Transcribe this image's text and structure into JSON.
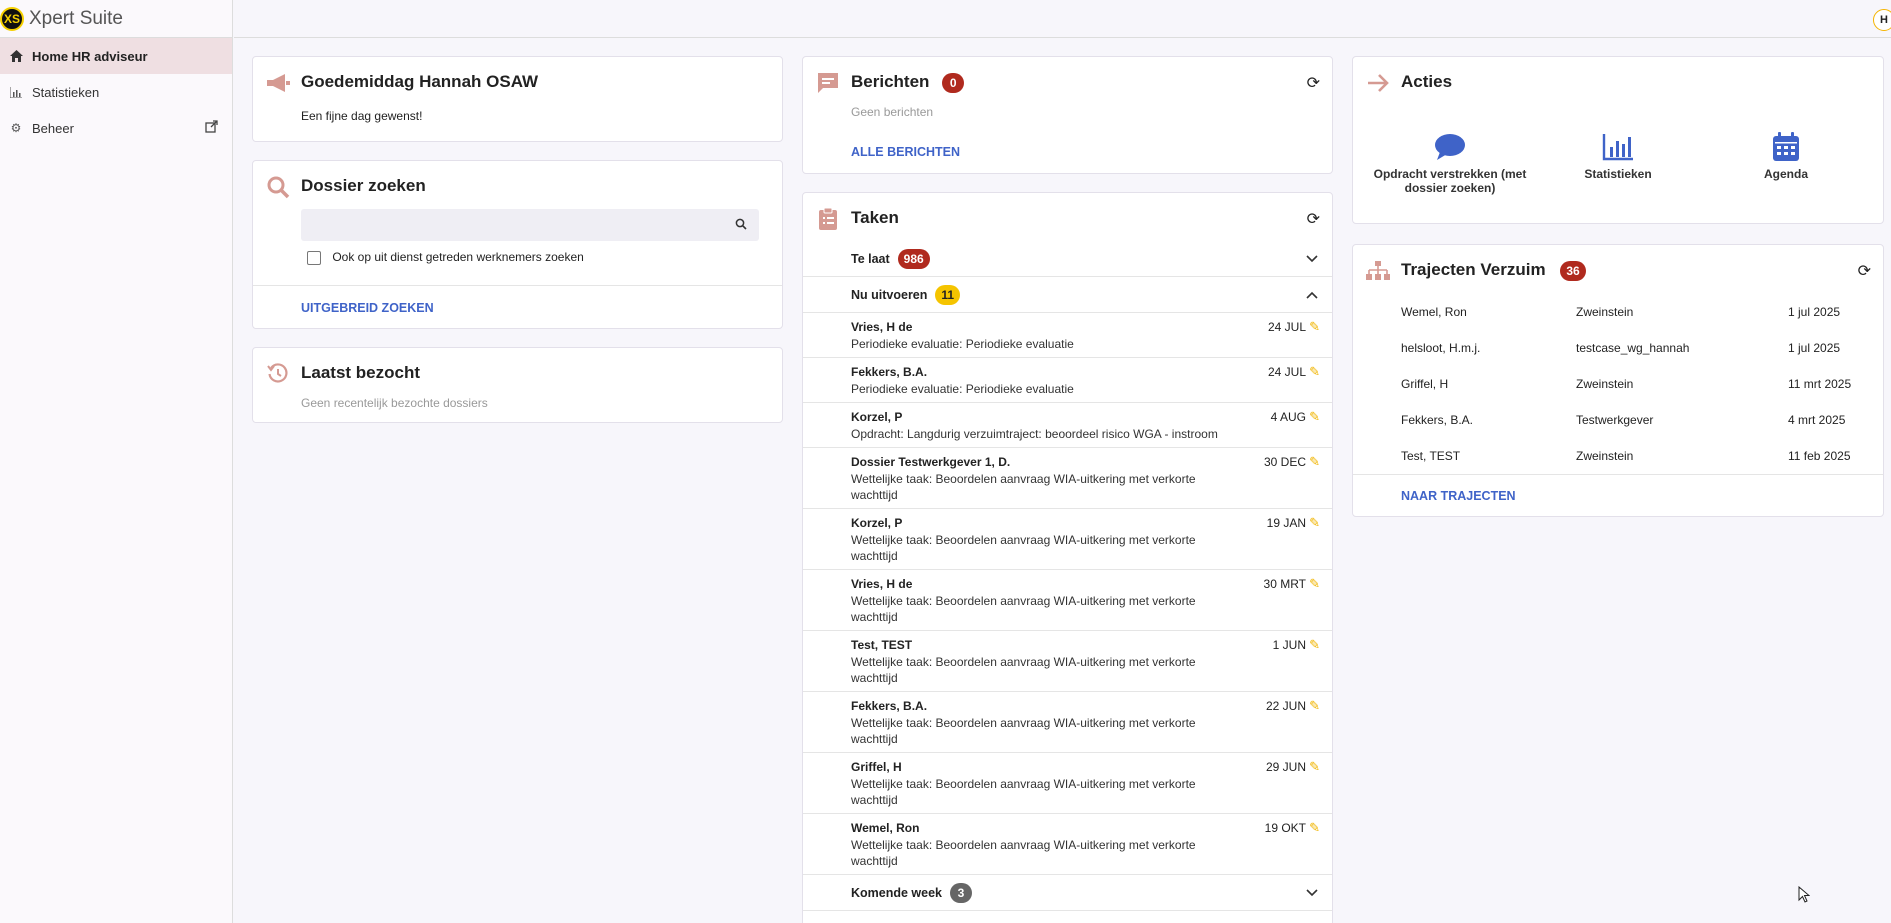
{
  "app": {
    "logo": "XS",
    "title": "Xpert Suite",
    "user_initial": "H"
  },
  "sidebar": {
    "items": [
      {
        "label": "Home HR adviseur",
        "icon": "home-icon"
      },
      {
        "label": "Statistieken",
        "icon": "chart-icon"
      },
      {
        "label": "Beheer",
        "icon": "gear-icon"
      }
    ]
  },
  "greeting": {
    "title": "Goedemiddag Hannah OSAW",
    "message": "Een fijne dag gewenst!"
  },
  "dossier": {
    "title": "Dossier zoeken",
    "search_placeholder": "",
    "checkbox_label": "Ook op uit dienst getreden werknemers zoeken",
    "advanced_link": "UITGEBREID ZOEKEN"
  },
  "recent": {
    "title": "Laatst bezocht",
    "empty": "Geen recentelijk bezochte dossiers"
  },
  "berichten": {
    "title": "Berichten",
    "count": "0",
    "empty": "Geen berichten",
    "all_link": "ALLE BERICHTEN"
  },
  "taken": {
    "title": "Taken",
    "groups": [
      {
        "label": "Te laat",
        "count": "986"
      },
      {
        "label": "Nu uitvoeren",
        "count": "11"
      },
      {
        "label": "Komende week",
        "count": "3"
      }
    ],
    "items": [
      {
        "name": "Vries, H de",
        "desc": "Periodieke evaluatie: Periodieke evaluatie",
        "date": "24 JUL"
      },
      {
        "name": "Fekkers, B.A.",
        "desc": "Periodieke evaluatie: Periodieke evaluatie",
        "date": "24 JUL"
      },
      {
        "name": "Korzel, P",
        "desc": "Opdracht: Langdurig verzuimtraject: beoordeel risico WGA - instroom",
        "date": "4 AUG"
      },
      {
        "name": "Dossier Testwerkgever 1, D.",
        "desc": "Wettelijke taak: Beoordelen aanvraag WIA-uitkering met verkorte wachttijd",
        "date": "30 DEC"
      },
      {
        "name": "Korzel, P",
        "desc": "Wettelijke taak: Beoordelen aanvraag WIA-uitkering met verkorte wachttijd",
        "date": "19 JAN"
      },
      {
        "name": "Vries, H de",
        "desc": "Wettelijke taak: Beoordelen aanvraag WIA-uitkering met verkorte wachttijd",
        "date": "30 MRT"
      },
      {
        "name": "Test, TEST",
        "desc": "Wettelijke taak: Beoordelen aanvraag WIA-uitkering met verkorte wachttijd",
        "date": "1 JUN"
      },
      {
        "name": "Fekkers, B.A.",
        "desc": "Wettelijke taak: Beoordelen aanvraag WIA-uitkering met verkorte wachttijd",
        "date": "22 JUN"
      },
      {
        "name": "Griffel, H",
        "desc": "Wettelijke taak: Beoordelen aanvraag WIA-uitkering met verkorte wachttijd",
        "date": "29 JUN"
      },
      {
        "name": "Wemel, Ron",
        "desc": "Wettelijke taak: Beoordelen aanvraag WIA-uitkering met verkorte wachttijd",
        "date": "19 OKT"
      }
    ]
  },
  "acties": {
    "title": "Acties",
    "items": [
      {
        "label": "Opdracht verstrekken (met dossier zoeken)",
        "icon": "chat-bubble-icon"
      },
      {
        "label": "Statistieken",
        "icon": "bar-chart-icon"
      },
      {
        "label": "Agenda",
        "icon": "calendar-icon"
      }
    ]
  },
  "trajecten": {
    "title": "Trajecten Verzuim",
    "count": "36",
    "rows": [
      {
        "name": "Wemel, Ron",
        "employer": "Zweinstein",
        "date": "1 jul 2025"
      },
      {
        "name": "helsloot, H.m.j.",
        "employer": "testcase_wg_hannah",
        "date": "1 jul 2025"
      },
      {
        "name": "Griffel, H",
        "employer": "Zweinstein",
        "date": "11 mrt 2025"
      },
      {
        "name": "Fekkers, B.A.",
        "employer": "Testwerkgever",
        "date": "4 mrt 2025"
      },
      {
        "name": "Test, TEST",
        "employer": "Zweinstein",
        "date": "11 feb 2025"
      }
    ],
    "link": "NAAR TRAJECTEN"
  }
}
